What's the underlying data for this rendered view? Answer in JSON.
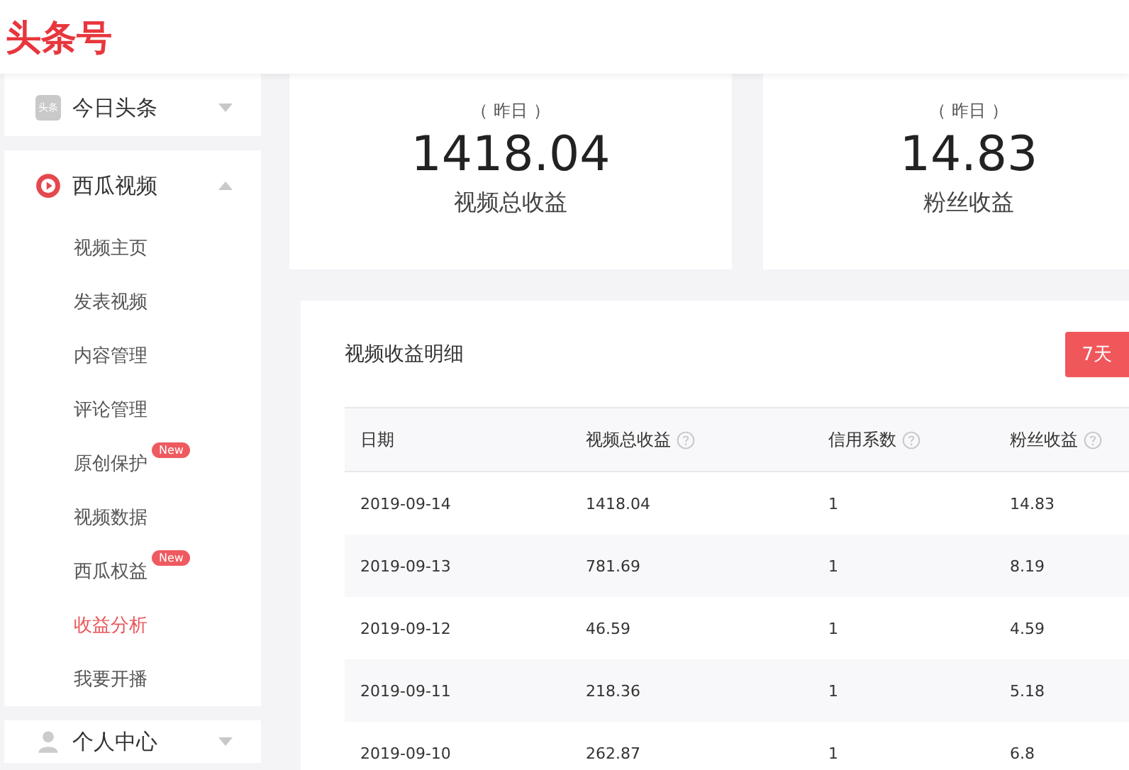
{
  "header": {
    "logo": "头条号"
  },
  "sidebar": {
    "groups": [
      {
        "label": "今日头条",
        "kind": "toutiao",
        "icon_text": "头条",
        "expanded": false
      },
      {
        "label": "西瓜视频",
        "kind": "xigua",
        "expanded": true,
        "items": [
          {
            "label": "视频主页",
            "selected": false
          },
          {
            "label": "发表视频",
            "selected": false
          },
          {
            "label": "内容管理",
            "selected": false
          },
          {
            "label": "评论管理",
            "selected": false
          },
          {
            "label": "原创保护",
            "selected": false,
            "badge": "New"
          },
          {
            "label": "视频数据",
            "selected": false
          },
          {
            "label": "西瓜权益",
            "selected": false,
            "badge": "New"
          },
          {
            "label": "收益分析",
            "selected": true
          },
          {
            "label": "我要开播",
            "selected": false
          }
        ]
      },
      {
        "label": "个人中心",
        "kind": "person",
        "expanded": false
      }
    ]
  },
  "stats": [
    {
      "period": "（ 昨日 ）",
      "value": "1418.04",
      "label": "视频总收益"
    },
    {
      "period": "（ 昨日 ）",
      "value": "14.83",
      "label": "粉丝收益"
    }
  ],
  "detail": {
    "title": "视频收益明细",
    "range_tabs": [
      {
        "label": "7天",
        "selected": true
      }
    ],
    "table": {
      "columns": [
        {
          "label": "日期",
          "help": false
        },
        {
          "label": "视频总收益",
          "help": true
        },
        {
          "label": "信用系数",
          "help": true
        },
        {
          "label": "粉丝收益",
          "help": true
        }
      ],
      "rows": [
        [
          "2019-09-14",
          "1418.04",
          "1",
          "14.83"
        ],
        [
          "2019-09-13",
          "781.69",
          "1",
          "8.19"
        ],
        [
          "2019-09-12",
          "46.59",
          "1",
          "4.59"
        ],
        [
          "2019-09-11",
          "218.36",
          "1",
          "5.18"
        ],
        [
          "2019-09-10",
          "262.87",
          "1",
          "6.8"
        ]
      ]
    }
  }
}
